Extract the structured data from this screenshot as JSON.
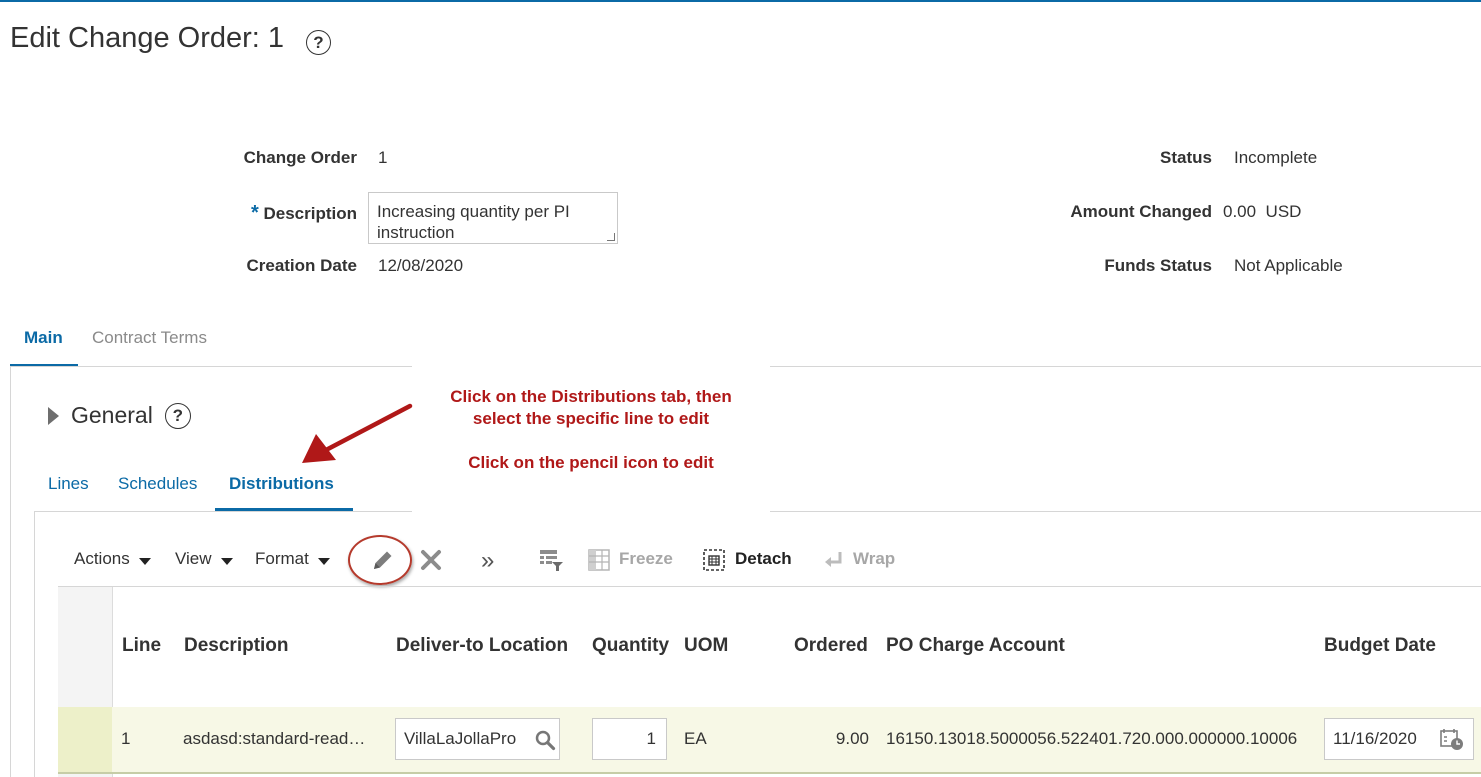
{
  "page": {
    "title": "Edit Change Order: 1",
    "help_glyph": "?"
  },
  "header": {
    "change_order_label": "Change Order",
    "change_order_value": "1",
    "required_marker": "*",
    "description_label": "Description",
    "description_value": "Increasing quantity per PI instruction",
    "creation_date_label": "Creation Date",
    "creation_date_value": "12/08/2020",
    "status_label": "Status",
    "status_value": "Incomplete",
    "amount_changed_label": "Amount Changed",
    "amount_changed_value": "0.00",
    "amount_changed_currency": "USD",
    "funds_status_label": "Funds Status",
    "funds_status_value": "Not Applicable"
  },
  "tabs": [
    {
      "label": "Main",
      "active": true
    },
    {
      "label": "Contract Terms",
      "active": false
    }
  ],
  "general": {
    "label": "General",
    "help_glyph": "?"
  },
  "subtabs": [
    {
      "label": "Lines",
      "active": false
    },
    {
      "label": "Schedules",
      "active": false
    },
    {
      "label": "Distributions",
      "active": true
    }
  ],
  "toolbar": {
    "actions_label": "Actions",
    "view_label": "View",
    "format_label": "Format",
    "edit_icon": "pencil-icon",
    "delete_icon": "x-icon",
    "more_glyph": "»",
    "freeze_label": "Freeze",
    "detach_label": "Detach",
    "wrap_label": "Wrap"
  },
  "table": {
    "columns": [
      "Line",
      "Description",
      "Deliver-to Location",
      "Quantity",
      "UOM",
      "Ordered",
      "PO Charge Account",
      "Budget Date"
    ],
    "rows": [
      {
        "line": "1",
        "description": "asdasd:standard-read…",
        "deliver_to_location": "VillaLaJollaPro",
        "quantity": "1",
        "uom": "EA",
        "ordered": "9.00",
        "po_charge_account": "16150.13018.5000056.522401.720.000.000000.10006",
        "budget_date": "11/16/2020"
      }
    ]
  },
  "callout": {
    "line1": "Click on the Distributions tab, then",
    "line2": "select the specific line to edit",
    "line3": "Click on the pencil icon to edit"
  },
  "colors": {
    "accent": "#0b6aa6",
    "annotation": "#b01818",
    "selected_row": "#f7f8e6"
  }
}
